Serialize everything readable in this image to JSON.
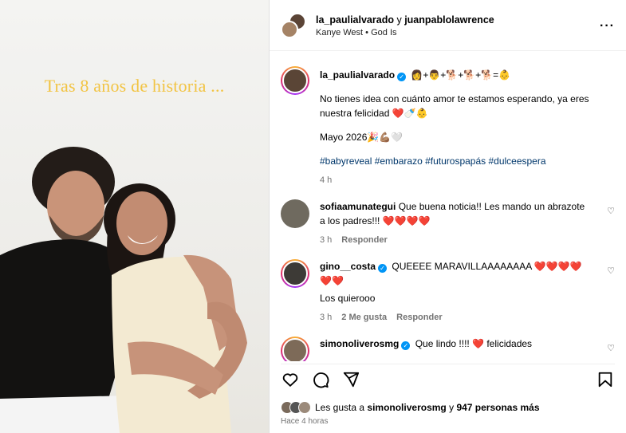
{
  "media": {
    "overlay_text": "Tras 8 años de historia ..."
  },
  "header": {
    "user1": "la_paulialvarado",
    "joiner": "y",
    "user2": "juanpablolawrence",
    "music_artist": "Kanye West",
    "music_sep": "•",
    "music_song": "God Is",
    "more_icon": "more-horizontal-icon"
  },
  "caption": {
    "username": "la_paulialvarado",
    "emojis": "👩+👨+🐕+🐕+🐕=👶",
    "line1": "No tienes idea con cuánto amor te estamos esperando, ya eres nuestra felicidad ❤️🍼👶",
    "line2": "Mayo 2026🎉💪🏽🤍",
    "hashtags": "#babyreveal #embarazo #futurospapás #dulceespera",
    "time": "4 h"
  },
  "comments": [
    {
      "username": "sofiaamunategui",
      "verified": false,
      "text": "Que buena noticia!! Les mando un abrazote a los padres!!! ❤️❤️❤️❤️",
      "time": "3 h",
      "likes": "",
      "reply": "Responder",
      "avatar_color": "#6f6a5f"
    },
    {
      "username": "gino__costa",
      "verified": true,
      "text": "QUEEEE MARAVILLAAAAAAAA ❤️❤️❤️❤️❤️❤️",
      "text2": "Los quierooo",
      "time": "3 h",
      "likes": "2 Me gusta",
      "reply": "Responder",
      "avatar_color": "#3d3a36"
    },
    {
      "username": "simonoliverosmg",
      "verified": true,
      "text": "Que lindo !!!! ❤️ felicidades",
      "time": "",
      "likes": "",
      "reply": "",
      "avatar_color": "#7d6a58"
    }
  ],
  "actions": {
    "like_icon": "heart-icon",
    "comment_icon": "comment-icon",
    "share_icon": "send-icon",
    "save_icon": "bookmark-icon"
  },
  "likes": {
    "prefix": "Les gusta a",
    "user": "simonoliverosmg",
    "middle": "y",
    "count": "947 personas más"
  },
  "posted": "Hace 4 horas"
}
